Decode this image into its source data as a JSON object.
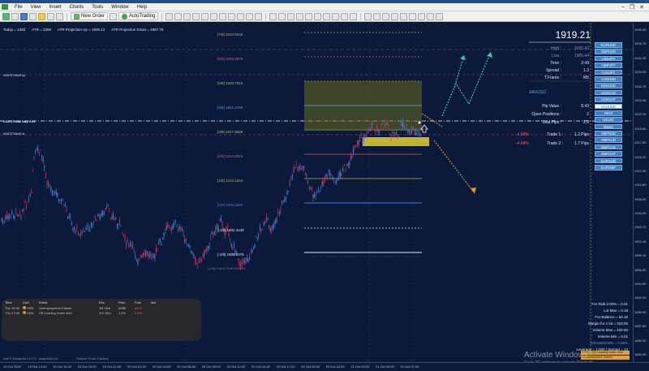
{
  "window": {
    "menu": [
      "File",
      "View",
      "Insert",
      "Charts",
      "Tools",
      "Window",
      "Help"
    ],
    "toolbar": {
      "new_order": "New Order",
      "autotrading": "AutoTrading"
    }
  },
  "hud": {
    "today": "Today = 1393",
    "atr": "ATR = 2269",
    "atr_up": "ATR Projection Up = 1935.13",
    "atr_down": "ATR Projection Down = 1897.76"
  },
  "levels": [
    {
      "label": "[7/8]",
      "price": "1933.5938",
      "color": "#d9a441"
    },
    {
      "label": "[6/8]",
      "price": "1929.6875",
      "color": "#d85a6a"
    },
    {
      "label": "[5/8]",
      "price": "1925.7813",
      "color": "#9bc34a"
    },
    {
      "label": "[4/8]",
      "price": "1921.8750",
      "color": "#4aa3e6"
    },
    {
      "label": "[3/8]",
      "price": "1917.9688",
      "color": "#9bc34a"
    },
    {
      "label": "[2/8]",
      "price": "1914.0625",
      "color": "#d85a6a"
    },
    {
      "label": "[1/8]",
      "price": "1910.1563",
      "color": "#d9a441"
    },
    {
      "label": "[0/8]",
      "price": "1906.2500",
      "color": "#4a7fe6"
    },
    {
      "label": "[-1/8]",
      "price": "1902.3438",
      "color": "#dfe6f4"
    },
    {
      "label": "[-2/8]",
      "price": "1898.4375",
      "color": "#dfe6f4"
    },
    {
      "label": "[-1/8] Frame Shift",
      "price": "1898.53",
      "color": "#6a7a9a"
    }
  ],
  "orders": {
    "tp": "#187274642 tp",
    "buy": "#187274642 buy 0.01",
    "sl": "#187274642 sl"
  },
  "info": {
    "price": "1919.21",
    "rows": [
      {
        "k": "High :",
        "v": "1920.43",
        "muted": true
      },
      {
        "k": "Low :",
        "v": "1906.44",
        "muted": true
      },
      {
        "k": "Time :",
        "v": "2:49",
        "muted": false
      },
      {
        "k": "Spread :",
        "v": "1.3",
        "muted": false
      },
      {
        "k": "T.Frame :",
        "v": "M5",
        "muted": false
      }
    ],
    "symbol": "XAUUSD",
    "rows2": [
      {
        "k": "Pip Value :",
        "v": "8.43"
      },
      {
        "k": "Open Positions :",
        "v": "2"
      },
      {
        "k": "Total Pips :",
        "v": "2.9"
      }
    ],
    "trades": [
      {
        "pct": "-4.68%",
        "label": "Trade 1 :",
        "v": "1.2 Pips"
      },
      {
        "pct": "-4.64%",
        "label": "Trade 2 :",
        "v": "1.7 Pips"
      }
    ]
  },
  "symbols": [
    "EURUSD",
    "GBPUSD",
    "USDJPY",
    "GBPJPY",
    "CADJPY",
    "AUDUSD",
    "NZDUSD",
    "USDCAD",
    "USDCHF",
    "XAUUSD",
    "NKSI",
    "UK100",
    "NDSX",
    "GBPNZD",
    "GBPAUD",
    "GBPCAD",
    "GBPCHF",
    "EURAUD",
    "EURGBP"
  ],
  "active_symbol": "XAUUSD",
  "calendar": {
    "headers": [
      "Time",
      "Curr.",
      "Event",
      "Exc.",
      "Prev.",
      "Fcst",
      "Act"
    ],
    "rows": [
      [
        "Thu 15:30",
        "USD",
        "Unemployment Claims",
        "JM 15m",
        "898K",
        "860K",
        ""
      ],
      [
        "Thu 17:00",
        "USD",
        "CB Leading Index m/m",
        "0% 45m",
        "1.2%",
        "0.8%",
        ""
      ]
    ]
  },
  "account": {
    "rows": [
      "For Risk 2.00% = 0.01",
      "Lot Max = 0.18",
      "For Balance = 62.16",
      "Margin for 1 lot = 323.05",
      "Volume Max = 100.00",
      "Volume Min = 0.01",
      "DRAWDOWN = 0.35%",
      "Leverage = 1:500 | Spread = 13"
    ]
  },
  "news_tags": [
    "17:00 : CB Leading Index m/m",
    "Unemployment Claims"
  ],
  "footer": {
    "left": "bwFX NewsInfo v1.7.0 - www.bwfx.eu",
    "source": "Source: Forex Factory"
  },
  "windows_notice": {
    "title": "Activate Windows",
    "sub": "Go to PC settings to activate Windows."
  },
  "price_axis": [
    "1935.65",
    "1933.75",
    "1931.35",
    "1929.05",
    "1926.75",
    "1924.45",
    "1922.15",
    "1919.85",
    "1917.55",
    "1915.25",
    "1912.95",
    "1910.65",
    "1908.35",
    "1906.05",
    "1903.75",
    "1901.45",
    "1899.15",
    "1896.85",
    "1894.55",
    "1892.25",
    "1889.95",
    "1887.65",
    "1885.35",
    "1883.05"
  ],
  "time_axis": [
    "19 Oct 2020",
    "19 Oct 13:40",
    "19 Oct 16:20",
    "19 Oct 19:00",
    "19 Oct 21:40",
    "20 Oct 01:20",
    "20 Oct 04:00",
    "20 Oct 06:40",
    "20 Oct 09:20",
    "20 Oct 12:00",
    "20 Oct 14:40",
    "20 Oct 17:20",
    "20 Oct 20:00",
    "20 Oct 22:40",
    "21 Oct 02:20",
    "21 Oct 05:00",
    "21 Oct 07:40"
  ]
}
